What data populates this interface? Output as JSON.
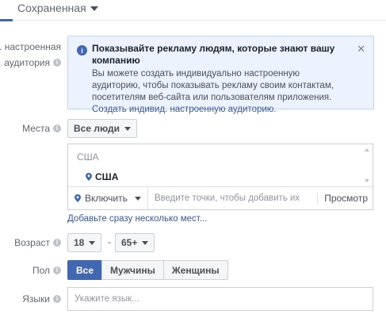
{
  "header": {
    "saved_label": "Сохраненная"
  },
  "custom_audiences": {
    "label_line1": "д. настроенная",
    "label_line2": "аудитория",
    "notice": {
      "title": "Показывайте рекламу людям, которые знают вашу компанию",
      "body": "Вы можете создать индивидуально настроенную аудиторию, чтобы показывать рекламу своим контактам, посетителям веб-сайта или пользователям приложения. ",
      "link": "Создать индивид. настроенную аудиторию."
    }
  },
  "places": {
    "label": "Места",
    "dropdown_value": "Все люди",
    "country_header": "США",
    "selected_location": "США",
    "include_label": "Включить",
    "input_placeholder": "Введите точки, чтобы добавить их",
    "browse_label": "Просмотр",
    "bulk_link": "Добавьте сразу несколько мест..."
  },
  "age": {
    "label": "Возраст",
    "from": "18",
    "dash": "-",
    "to": "65+"
  },
  "gender": {
    "label": "Пол",
    "options": [
      "Все",
      "Мужчины",
      "Женщины"
    ],
    "selected": "Все"
  },
  "languages": {
    "label": "Языки",
    "placeholder": "Укажите язык..."
  },
  "colors": {
    "accent": "#4267b2",
    "link": "#365899",
    "notice_bg": "#ecf3ff"
  }
}
